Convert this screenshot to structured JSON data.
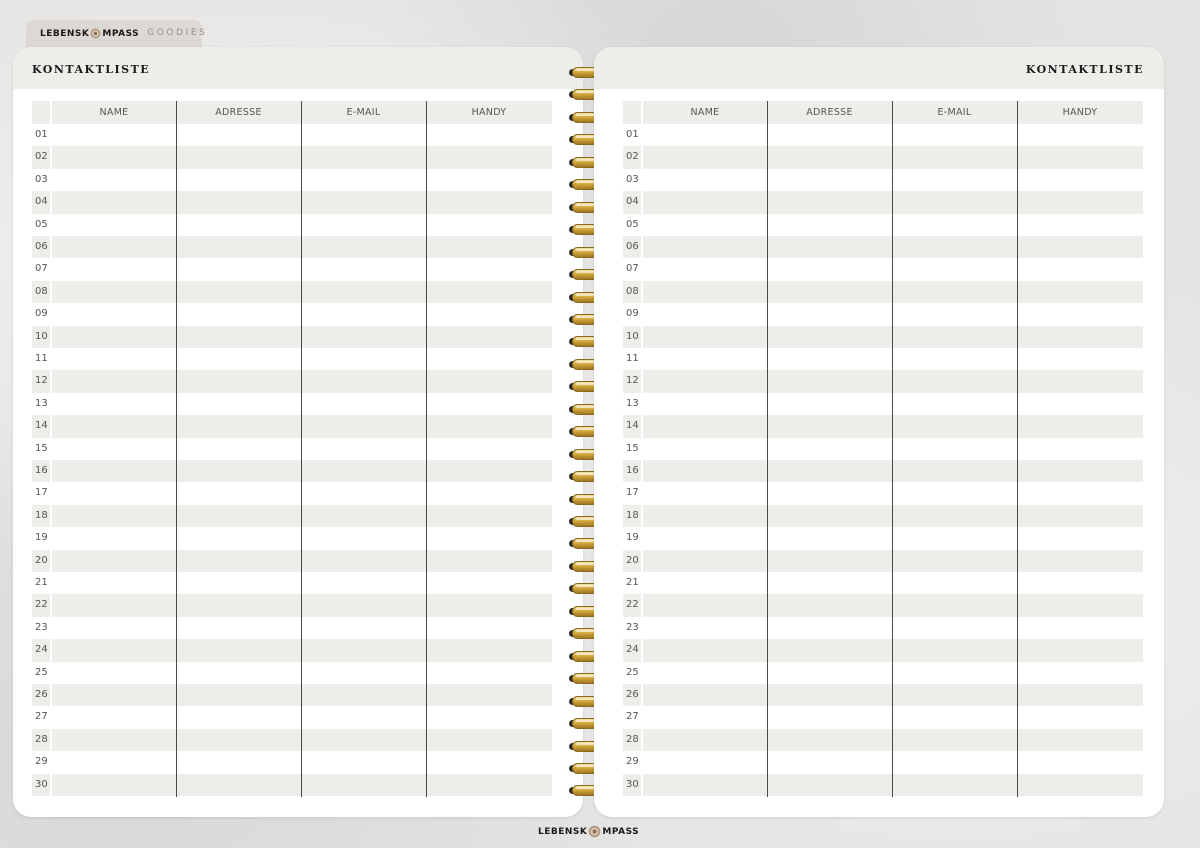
{
  "top_tab": {
    "brand_left": "LEBENSK",
    "brand_right": "MPASS",
    "label": "GOODIES"
  },
  "footer": {
    "brand_left": "LEBENSK",
    "brand_right": "MPASS"
  },
  "pages": [
    {
      "title": "KONTAKTLISTE",
      "columns": [
        "NAME",
        "ADRESSE",
        "E-MAIL",
        "HANDY"
      ],
      "rows": [
        "01",
        "02",
        "03",
        "04",
        "05",
        "06",
        "07",
        "08",
        "09",
        "10",
        "11",
        "12",
        "13",
        "14",
        "15",
        "16",
        "17",
        "18",
        "19",
        "20",
        "21",
        "22",
        "23",
        "24",
        "25",
        "26",
        "27",
        "28",
        "29",
        "30"
      ]
    },
    {
      "title": "KONTAKTLISTE",
      "columns": [
        "NAME",
        "ADRESSE",
        "E-MAIL",
        "HANDY"
      ],
      "rows": [
        "01",
        "02",
        "03",
        "04",
        "05",
        "06",
        "07",
        "08",
        "09",
        "10",
        "11",
        "12",
        "13",
        "14",
        "15",
        "16",
        "17",
        "18",
        "19",
        "20",
        "21",
        "22",
        "23",
        "24",
        "25",
        "26",
        "27",
        "28",
        "29",
        "30"
      ]
    }
  ],
  "colors": {
    "stripe": "#efedea",
    "page": "#ffffff",
    "background": "#e4e3e1",
    "ring_gold": "#d4a93e"
  },
  "spiral_ring_count": 33
}
